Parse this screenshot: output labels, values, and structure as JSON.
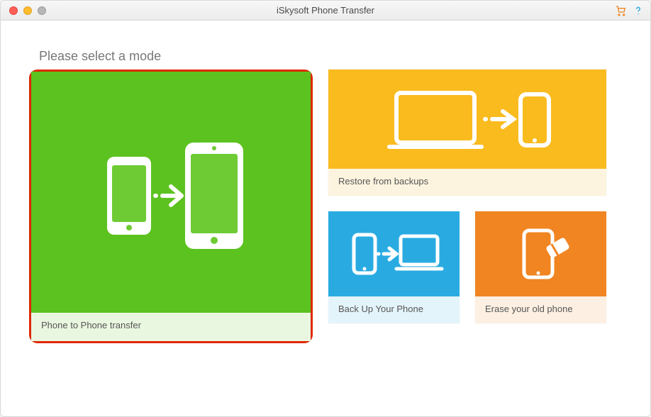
{
  "window": {
    "title": "iSkysoft Phone Transfer"
  },
  "header": {
    "cart_icon": "cart-icon",
    "help_icon": "help-icon"
  },
  "prompt": "Please select a mode",
  "modes": {
    "phone_to_phone": {
      "label": "Phone to Phone transfer",
      "color": "#5cc21f"
    },
    "restore": {
      "label": "Restore from backups",
      "color": "#f9bb1e"
    },
    "backup": {
      "label": "Back Up Your Phone",
      "color": "#29abe2"
    },
    "erase": {
      "label": "Erase your old phone",
      "color": "#f08522"
    }
  },
  "highlighted_mode": "phone_to_phone"
}
